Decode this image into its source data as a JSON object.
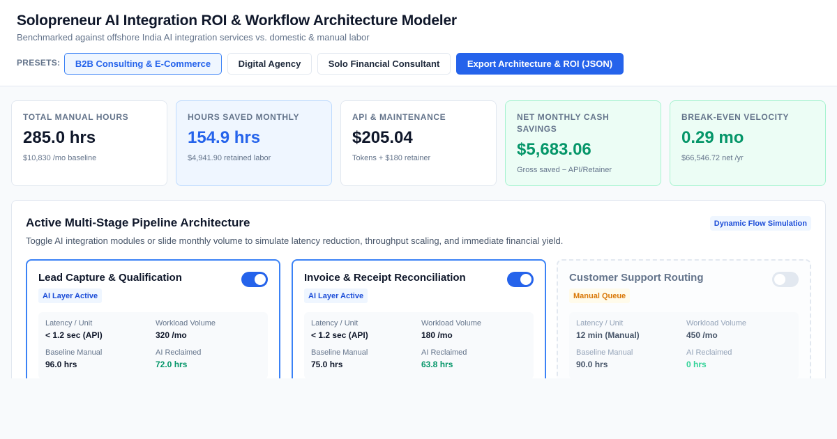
{
  "header": {
    "title": "Solopreneur AI Integration ROI & Workflow Architecture Modeler",
    "subtitle": "Benchmarked against offshore India AI integration services vs. domestic & manual labor",
    "presets_label": "PRESETS:",
    "presets": [
      {
        "label": "B2B Consulting & E-Commerce",
        "active": true
      },
      {
        "label": "Digital Agency",
        "active": false
      },
      {
        "label": "Solo Financial Consultant",
        "active": false
      }
    ],
    "export_label": "Export Architecture & ROI (JSON)"
  },
  "kpis": [
    {
      "label": "Total Manual Hours",
      "value": "285.0 hrs",
      "sub": "$10,830 /mo baseline"
    },
    {
      "label": "Hours Saved Monthly",
      "value": "154.9 hrs",
      "sub": "$4,941.90 retained labor"
    },
    {
      "label": "API & Maintenance",
      "value": "$205.04",
      "sub": "Tokens + $180 retainer"
    },
    {
      "label": "Net Monthly Cash Savings",
      "value": "$5,683.06",
      "sub": "Gross saved − API/Retainer"
    },
    {
      "label": "Break-Even Velocity",
      "value": "0.29 mo",
      "sub": "$66,546.72 net /yr"
    }
  ],
  "pipeline": {
    "title": "Active Multi-Stage Pipeline Architecture",
    "badge": "Dynamic Flow Simulation",
    "description": "Toggle AI integration modules or slide monthly volume to simulate latency reduction, throughput scaling, and immediate financial yield.",
    "metric_labels": {
      "latency": "Latency / Unit",
      "volume": "Workload Volume",
      "baseline": "Baseline Manual",
      "reclaimed": "AI Reclaimed"
    },
    "stages": [
      {
        "name": "Lead Capture & Qualification",
        "enabled": true,
        "status": "AI Layer Active",
        "latency": "< 1.2 sec (API)",
        "volume": "320 /mo",
        "baseline": "96.0 hrs",
        "reclaimed": "72.0 hrs"
      },
      {
        "name": "Invoice & Receipt Reconciliation",
        "enabled": true,
        "status": "AI Layer Active",
        "latency": "< 1.2 sec (API)",
        "volume": "180 /mo",
        "baseline": "75.0 hrs",
        "reclaimed": "63.8 hrs"
      },
      {
        "name": "Customer Support Routing",
        "enabled": false,
        "status": "Manual Queue",
        "latency": "12 min (Manual)",
        "volume": "450 /mo",
        "baseline": "90.0 hrs",
        "reclaimed": "0 hrs"
      }
    ]
  },
  "colors": {
    "accent": "#2563eb",
    "positive": "#059669",
    "manual": "#d97706"
  }
}
